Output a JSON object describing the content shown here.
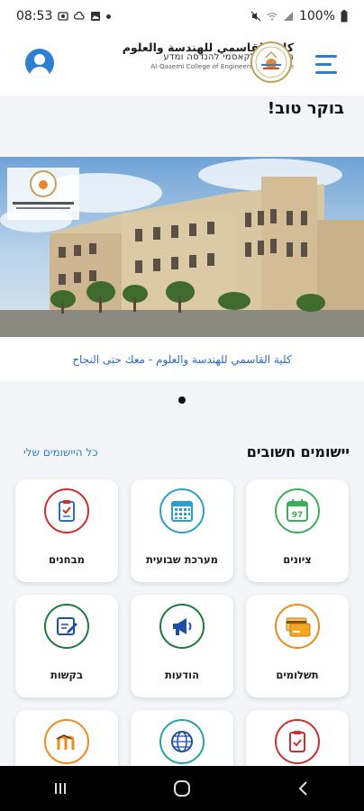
{
  "status_bar": {
    "time": "08:53",
    "battery": "100%"
  },
  "header": {
    "logo_ar": "كلية القاسمي للهندسة والعلوم",
    "logo_he": "מכללת אלקאסמי להנדסה ומדע",
    "logo_en": "Al-Qasemi College of Engineering & Science"
  },
  "greeting": "בוקר טוב!",
  "banner": {
    "caption": "كلية القاسمي للهندسة والعلوم - معك حتى النجاح",
    "slide_index": 1,
    "slide_count": 1
  },
  "apps_section": {
    "title": "יישומים חשובים",
    "link": "כל היישומים שלי"
  },
  "tiles": [
    {
      "label": "ציונים",
      "icon": "grades-calendar-icon",
      "badge": "97",
      "color": "#3fae5a"
    },
    {
      "label": "מערכת שבועית",
      "icon": "weekly-schedule-icon",
      "color": "#2b9fc9"
    },
    {
      "label": "מבחנים",
      "icon": "exams-clipboard-icon",
      "color": "#c9302f"
    },
    {
      "label": "תשלומים",
      "icon": "payment-card-icon",
      "color": "#e98b1d"
    },
    {
      "label": "הודעות",
      "icon": "megaphone-icon",
      "color": "#1c7a3a"
    },
    {
      "label": "בקשות",
      "icon": "requests-edit-icon",
      "color": "#1c7a3a"
    },
    {
      "label": "",
      "icon": "tasks-clipboard-icon",
      "color": "#c9302f"
    },
    {
      "label": "",
      "icon": "globe-icon",
      "color": "#2aa49a"
    },
    {
      "label": "",
      "icon": "moodle-icon",
      "color": "#f08a1d"
    }
  ],
  "nav": {
    "recent": "recents-icon",
    "home": "home-icon",
    "back": "back-icon"
  }
}
